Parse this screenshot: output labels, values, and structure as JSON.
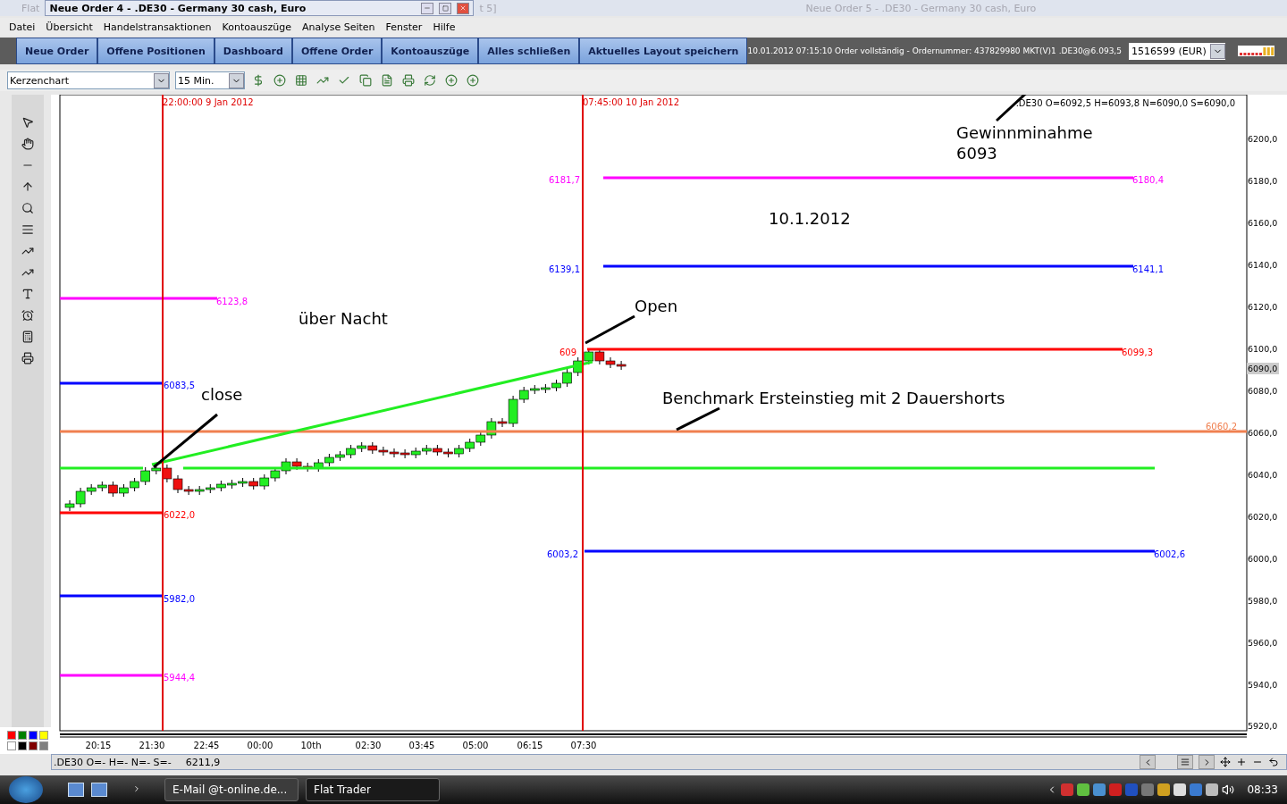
{
  "background_windows": {
    "left_title": "Flat",
    "fragment": "t 5]",
    "right_title": "Neue Order 5 - .DE30 - Germany 30 cash, Euro"
  },
  "window": {
    "title": "Neue Order 4 - .DE30 - Germany 30 cash, Euro"
  },
  "menu": [
    "Datei",
    "Übersicht",
    "Handelstransaktionen",
    "Kontoauszüge",
    "Analyse Seiten",
    "Fenster",
    "Hilfe"
  ],
  "action_buttons": [
    "Neue Order",
    "Offene Positionen",
    "Dashboard",
    "Offene Order",
    "Kontoauszüge",
    "Alles schließen",
    "Aktuelles Layout speichern"
  ],
  "status_message": "10.01.2012 07:15:10 Order vollständig - Ordernummer: 437829980 MKT(V)1 .DE30@6.093,5",
  "account": "1516599 (EUR)",
  "chart_toolbar": {
    "chart_type": "Kerzenchart",
    "interval": "15 Min."
  },
  "chart": {
    "header": ".DE30 O=6092,5 H=6093,8 N=6090,0 S=6090,0",
    "vertical_markers": [
      "22:00:00 9 Jan 2012",
      "07:45:00 10 Jan 2012"
    ],
    "levels": [
      {
        "left_label": "6123,8",
        "color": "#ff00ff"
      },
      {
        "left_label": "6083,5",
        "color": "#0000ff"
      },
      {
        "left_label": "6022,0",
        "color": "#ff0000"
      },
      {
        "left_label": "5982,0",
        "color": "#0000ff"
      },
      {
        "left_label": "5944,4",
        "color": "#ff00ff"
      },
      {
        "left_label": "6181,7",
        "right_label": "6180,4",
        "color": "#ff00ff"
      },
      {
        "left_label": "6139,1",
        "right_label": "6141,1",
        "color": "#0000ff"
      },
      {
        "left_label": "609",
        "right_label": "6099,3",
        "color": "#ff0000"
      },
      {
        "left_label": "6003,2",
        "right_label": "6002,6",
        "color": "#0000ff"
      },
      {
        "right_label": "6060,2",
        "color": "#f08050"
      },
      {
        "color": "#22ee22"
      }
    ],
    "annotations": [
      "Gewinnminahme",
      "6093",
      "10.1.2012",
      "über Nacht",
      "Open",
      "close",
      "Benchmark Ersteinstieg mit 2 Dauershorts"
    ],
    "y_axis": [
      "6200,0",
      "6180,0",
      "6160,0",
      "6140,0",
      "6120,0",
      "6100,0",
      "6080,0",
      "6060,0",
      "6040,0",
      "6020,0",
      "6000,0",
      "5980,0",
      "5960,0",
      "5940,0",
      "5920,0"
    ],
    "current_price": "6090,0",
    "x_axis": [
      "20:15",
      "21:30",
      "22:45",
      "00:00",
      "10th",
      "02:30",
      "03:45",
      "05:00",
      "06:15",
      "07:30"
    ]
  },
  "palette": [
    {
      "color": "#ff0000"
    },
    {
      "color": "#008000"
    },
    {
      "color": "#0000ff"
    },
    {
      "color": "#ffff00"
    },
    {
      "color": "#ffffff"
    },
    {
      "color": "#000000"
    },
    {
      "color": "#800000"
    },
    {
      "color": "#808080"
    }
  ],
  "status_bar": {
    "quote": ".DE30 O=- H=- N=- S=-",
    "value": "6211,9"
  },
  "taskbar": {
    "tasks": [
      {
        "label": "E-Mail @t-online.de...",
        "selected": false
      },
      {
        "label": "Flat Trader",
        "selected": true
      }
    ],
    "clock": "08:33"
  }
}
